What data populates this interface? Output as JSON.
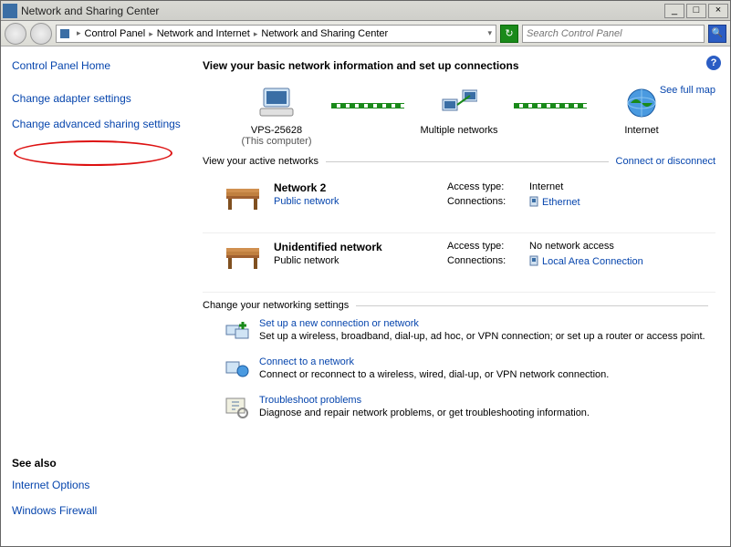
{
  "titlebar": {
    "title": "Network and Sharing Center"
  },
  "breadcrumb": {
    "items": [
      "Control Panel",
      "Network and Internet",
      "Network and Sharing Center"
    ]
  },
  "search": {
    "placeholder": "Search Control Panel"
  },
  "sidebar": {
    "home": "Control Panel Home",
    "links": [
      "Change adapter settings",
      "Change advanced sharing settings"
    ],
    "seealso_hdr": "See also",
    "seealso": [
      "Internet Options",
      "Windows Firewall"
    ]
  },
  "main": {
    "heading": "View your basic network information and set up connections",
    "fullmap": "See full map",
    "map": {
      "node1": "VPS-25628",
      "node1sub": "(This computer)",
      "node2": "Multiple networks",
      "node3": "Internet"
    },
    "active_hdr": "View your active networks",
    "active_rlink": "Connect or disconnect",
    "networks": [
      {
        "name": "Network  2",
        "type": "Public network",
        "type_link": true,
        "access_k": "Access type:",
        "access_v": "Internet",
        "conn_k": "Connections:",
        "conn_v": "Ethernet"
      },
      {
        "name": "Unidentified network",
        "type": "Public network",
        "type_link": false,
        "access_k": "Access type:",
        "access_v": "No network access",
        "conn_k": "Connections:",
        "conn_v": "Local Area Connection"
      }
    ],
    "settings_hdr": "Change your networking settings",
    "tasks": [
      {
        "title": "Set up a new connection or network",
        "desc": "Set up a wireless, broadband, dial-up, ad hoc, or VPN connection; or set up a router or access point."
      },
      {
        "title": "Connect to a network",
        "desc": "Connect or reconnect to a wireless, wired, dial-up, or VPN network connection."
      },
      {
        "title": "Troubleshoot problems",
        "desc": "Diagnose and repair network problems, or get troubleshooting information."
      }
    ]
  }
}
